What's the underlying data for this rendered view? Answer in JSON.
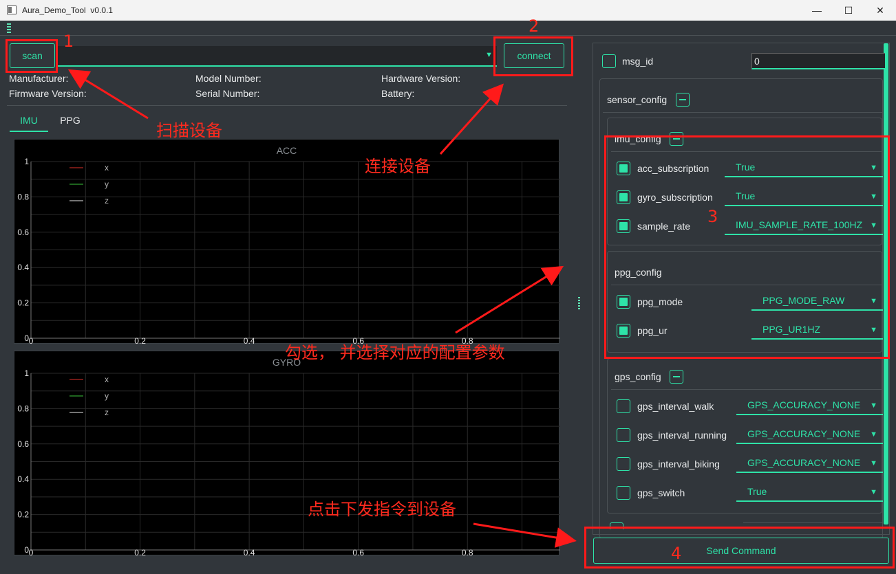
{
  "window": {
    "title": "Aura_Demo_Tool  v0.0.1",
    "minimize": "—",
    "maximize": "☐",
    "close": "✕"
  },
  "toolbar": {
    "scan_label": "scan",
    "connect_label": "connect",
    "device_value": ""
  },
  "device_info": {
    "manufacturer": "Manufacturer:",
    "model_number": "Model Number:",
    "hardware_version": "Hardware Version:",
    "firmware_version": "Firmware Version:",
    "serial_number": "Serial Number:",
    "battery": "Battery:"
  },
  "tabs": [
    {
      "label": "IMU",
      "active": true
    },
    {
      "label": "PPG",
      "active": false
    }
  ],
  "plots": {
    "acc": {
      "title": "ACC",
      "x_ticks": [
        "0",
        "0.2",
        "0.4",
        "0.6",
        "0.8"
      ],
      "y_ticks": [
        "0",
        "0.2",
        "0.4",
        "0.6",
        "0.8",
        "1"
      ],
      "legend": [
        "x",
        "y",
        "z"
      ]
    },
    "gyro": {
      "title": "GYRO",
      "x_ticks": [
        "0",
        "0.2",
        "0.4",
        "0.6",
        "0.8"
      ],
      "y_ticks": [
        "0",
        "0.2",
        "0.4",
        "0.6",
        "0.8",
        "1"
      ],
      "legend": [
        "x",
        "y",
        "z"
      ]
    },
    "legend_colors": [
      "#e0302a",
      "#3cc93c",
      "#e8e8e8"
    ]
  },
  "config": {
    "msg_id": {
      "label": "msg_id",
      "value": "0",
      "checked": false
    },
    "sensor_config": {
      "label": "sensor_config"
    },
    "imu_config": {
      "label": "imu_config",
      "items": [
        {
          "label": "acc_subscription",
          "value": "True",
          "checked": true
        },
        {
          "label": "gyro_subscription",
          "value": "True",
          "checked": true
        },
        {
          "label": "sample_rate",
          "value": "IMU_SAMPLE_RATE_100HZ",
          "checked": true
        }
      ]
    },
    "ppg_config": {
      "label": "ppg_config",
      "items": [
        {
          "label": "ppg_mode",
          "value": "PPG_MODE_RAW",
          "checked": true
        },
        {
          "label": "ppg_ur",
          "value": "PPG_UR1HZ",
          "checked": true
        }
      ]
    },
    "gps_config": {
      "label": "gps_config",
      "items": [
        {
          "label": "gps_interval_walk",
          "value": "GPS_ACCURACY_NONE",
          "checked": false
        },
        {
          "label": "gps_interval_running",
          "value": "GPS_ACCURACY_NONE",
          "checked": false
        },
        {
          "label": "gps_interval_biking",
          "value": "GPS_ACCURACY_NONE",
          "checked": false
        },
        {
          "label": "gps_switch",
          "value": "True",
          "checked": false
        }
      ]
    }
  },
  "send_label": "Send Command",
  "annotations": {
    "n1": "1",
    "n2": "2",
    "n3": "3",
    "n4": "4",
    "scan": "扫描设备",
    "connect": "连接设备",
    "select": "勾选， 并选择对应的配置参数",
    "send": "点击下发指令到设备"
  },
  "colors": {
    "accent": "#2ee3a8",
    "background": "#31363b",
    "annotation": "#ff2a1e"
  }
}
